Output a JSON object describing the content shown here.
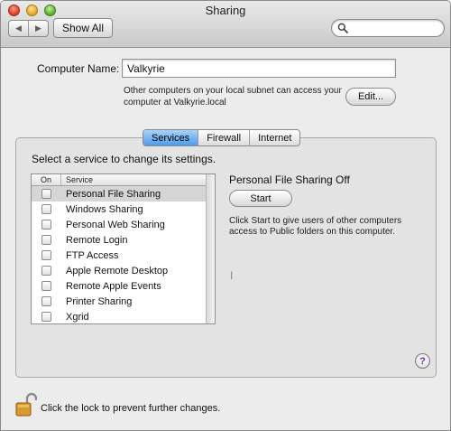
{
  "window": {
    "title": "Sharing"
  },
  "toolbar": {
    "back_glyph": "◀",
    "forward_glyph": "▶",
    "show_all_label": "Show All",
    "search_placeholder": ""
  },
  "computer_name": {
    "label": "Computer Name:",
    "value": "Valkyrie",
    "help_text": "Other computers on your local subnet can access your computer at Valkyrie.local",
    "edit_label": "Edit..."
  },
  "tabs": [
    {
      "label": "Services",
      "active": true
    },
    {
      "label": "Firewall",
      "active": false
    },
    {
      "label": "Internet",
      "active": false
    }
  ],
  "services": {
    "prompt": "Select a service to change its settings.",
    "col_on": "On",
    "col_service": "Service",
    "items": [
      {
        "name": "Personal File Sharing",
        "on": false,
        "selected": true
      },
      {
        "name": "Windows Sharing",
        "on": false,
        "selected": false
      },
      {
        "name": "Personal Web Sharing",
        "on": false,
        "selected": false
      },
      {
        "name": "Remote Login",
        "on": false,
        "selected": false
      },
      {
        "name": "FTP Access",
        "on": false,
        "selected": false
      },
      {
        "name": "Apple Remote Desktop",
        "on": false,
        "selected": false
      },
      {
        "name": "Remote Apple Events",
        "on": false,
        "selected": false
      },
      {
        "name": "Printer Sharing",
        "on": false,
        "selected": false
      },
      {
        "name": "Xgrid",
        "on": false,
        "selected": false
      }
    ]
  },
  "detail": {
    "status_title": "Personal File Sharing Off",
    "start_label": "Start",
    "help_text": "Click Start to give users of other computers access to Public folders on this computer."
  },
  "help_button": {
    "glyph": "?"
  },
  "lock": {
    "text": "Click the lock to prevent further changes."
  },
  "colors": {
    "accent": "#4f9be9",
    "help_glyph": "#6b2fb3",
    "lock": "#c98a1a"
  }
}
